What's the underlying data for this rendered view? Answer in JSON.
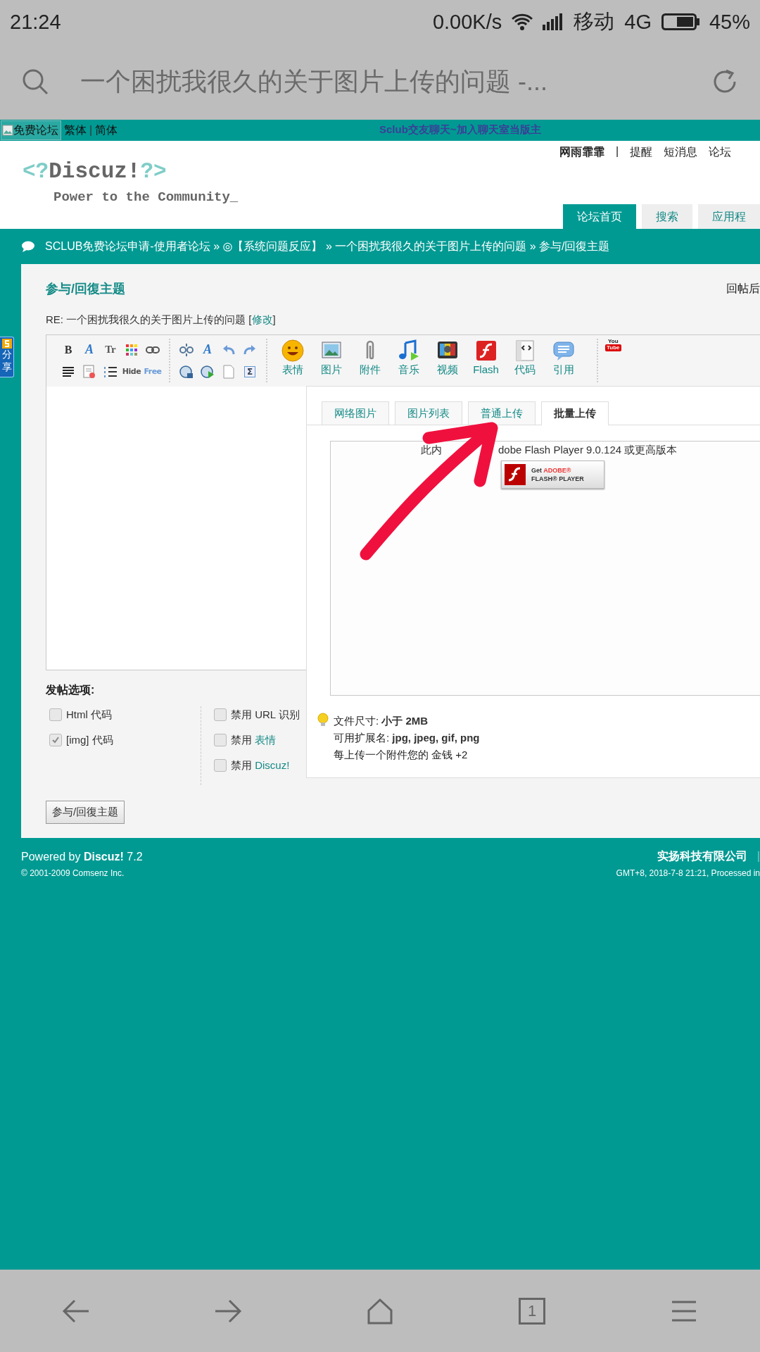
{
  "status_bar": {
    "time": "21:24",
    "speed": "0.00K/s",
    "carrier": "移动",
    "network": "4G",
    "battery": "45%"
  },
  "address_bar": {
    "title": "一个困扰我很久的关于图片上传的问题 -..."
  },
  "top_strip": {
    "logo_alt": "免费论坛",
    "links": [
      "繁体",
      "简体"
    ],
    "separator": "|",
    "promo": "Sclub交友聊天~加入聊天室当版主"
  },
  "header": {
    "logo": {
      "open": "<?",
      "name": "Discuz!",
      "close": "?>",
      "slogan": "Power to the Community_"
    },
    "user": "网雨霏霏",
    "separator": "|",
    "links": [
      "提醒",
      "短消息",
      "论坛"
    ],
    "tabs": [
      {
        "label": "论坛首页",
        "selected": true
      },
      {
        "label": "搜索",
        "selected": false
      },
      {
        "label": "应用程",
        "selected": false
      }
    ]
  },
  "breadcrumb": "SCLUB免费论坛申请-使用者论坛 » ◎【系统问题反应】 » 一个困扰我很久的关于图片上传的问题 » 参与/回復主题",
  "share": {
    "label": "分享"
  },
  "post": {
    "heading": "参与/回復主题",
    "side_note": "回帖后",
    "subject": "RE: 一个困扰我很久的关于图片上传的问题 [",
    "edit_link": "修改",
    "subject_end": "]"
  },
  "editor": {
    "tool_groups": [
      [
        {
          "kind": "bold",
          "glyph": "B"
        },
        {
          "kind": "font",
          "glyph": "A"
        },
        {
          "kind": "size",
          "glyph": "Tr"
        },
        {
          "kind": "color"
        },
        {
          "kind": "link"
        },
        {
          "kind": "align"
        },
        {
          "kind": "remove"
        },
        {
          "kind": "list"
        },
        {
          "kind": "hide",
          "glyph": "Hide"
        },
        {
          "kind": "free",
          "glyph": "Free"
        }
      ],
      [
        {
          "kind": "unlink"
        },
        {
          "kind": "clear",
          "glyph": "A"
        },
        {
          "kind": "undo"
        },
        {
          "kind": "redo"
        },
        {
          "kind": "media"
        },
        {
          "kind": "play"
        },
        {
          "kind": "page"
        },
        {
          "kind": "sigma",
          "glyph": "Σ"
        }
      ]
    ],
    "big_tools": [
      {
        "kind": "smiley",
        "label": "表情"
      },
      {
        "kind": "image",
        "label": "图片"
      },
      {
        "kind": "clip",
        "label": "附件"
      },
      {
        "kind": "music",
        "label": "音乐"
      },
      {
        "kind": "tv",
        "label": "视频"
      },
      {
        "kind": "flash",
        "label": "Flash"
      },
      {
        "kind": "code",
        "label": "代码"
      },
      {
        "kind": "quote",
        "label": "引用"
      }
    ],
    "youtube": {
      "top": "You",
      "bottom": "Tube"
    }
  },
  "upload": {
    "tabs": [
      {
        "label": "网络图片",
        "selected": false
      },
      {
        "label": "图片列表",
        "selected": false
      },
      {
        "label": "普通上传",
        "selected": false
      },
      {
        "label": "批量上传",
        "selected": true
      }
    ],
    "notice": {
      "start": "此内",
      "end": "dobe Flash Player 9.0.124 或更高版本"
    },
    "badge": {
      "get": "Get",
      "brand": "ADOBE®",
      "product": "FLASH® PLAYER"
    },
    "info": [
      "文件尺寸: **小于 2MB**",
      "可用扩展名: **jpg, jpeg, gif, png**",
      "每上传一个附件您的 金钱 +2"
    ]
  },
  "options": {
    "title": "发帖选项:",
    "left": [
      {
        "label": "Html 代码",
        "checked": false
      },
      {
        "label": "[img] 代码",
        "checked": true
      }
    ],
    "right": [
      {
        "label": "禁用 URL 识别",
        "checked": false
      },
      {
        "label": "禁用 ",
        "link": "表情",
        "checked": false
      },
      {
        "label": "禁用 ",
        "link": "Discuz!",
        "checked": false
      }
    ]
  },
  "submit": "参与/回復主题",
  "footer": {
    "powered": "Powered by **Discuz!** 7.2",
    "copyright": "© 2001-2009 Comsenz Inc.",
    "company": "实扬科技有限公司",
    "separator": "|",
    "time": "GMT+8, 2018-7-8 21:21, Processed in"
  },
  "nav_bar": {
    "tab_count": "1"
  }
}
